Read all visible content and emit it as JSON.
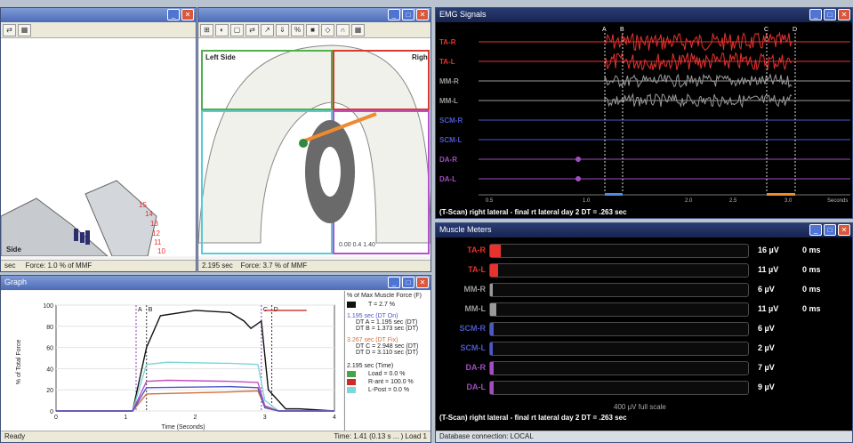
{
  "colors": {
    "red": "#e8322e",
    "gray": "#9a9a9a",
    "blue": "#4d57c8",
    "purple": "#a24ec2"
  },
  "force_window": {
    "status": "Force: 1.0 % of MMF",
    "left_status": "sec",
    "side_label": "Side",
    "numbers": [
      "15",
      "14",
      "13",
      "12",
      "11",
      "10"
    ]
  },
  "arch_window": {
    "title": "",
    "left_label": "Left Side",
    "right_label": "Righ",
    "time": "2.195 sec",
    "status": "Force: 3.7 % of MMF",
    "coords": "0.00 0.4 1.40"
  },
  "graph_window": {
    "title": "Graph",
    "y_label": "% of Total Force",
    "x_label": "Time (Seconds)",
    "status_left": "Ready",
    "status_right": "Time: 1.41 (0.13 s ... ) Load 1",
    "legend": {
      "header": "% of Max Muscle Force (F)",
      "total": "T = 2.7 %",
      "sel1": "1.195 sec (DT On)",
      "sel1_a": "DT A = 1.195 sec (DT)",
      "sel1_b": "DT B = 1.373 sec (DT)",
      "sel2": "3.267 sec (DT Fix)",
      "sel2_a": "DT C = 2.948 sec (DT)",
      "sel2_b": "DT D = 3.110 sec (DT)",
      "time_row": "2.195 sec (Time)",
      "l1": "Load = 0.0 %",
      "l2": "R-ant = 100.0 %",
      "l3": "L-Post = 0.0 %"
    }
  },
  "chart_data": {
    "type": "line",
    "xlim": [
      0,
      4
    ],
    "ylim": [
      0,
      100
    ],
    "x_ticks": [
      "0",
      "1",
      "2",
      "3",
      "4"
    ],
    "y_ticks": [
      "0",
      "20",
      "40",
      "60",
      "80",
      "100"
    ],
    "markers": [
      "A",
      "B",
      "C",
      "D"
    ],
    "series": [
      {
        "color": "#111111",
        "points": [
          [
            0,
            0
          ],
          [
            1.1,
            0
          ],
          [
            1.3,
            60
          ],
          [
            1.5,
            90
          ],
          [
            2.0,
            95
          ],
          [
            2.5,
            93
          ],
          [
            2.7,
            85
          ],
          [
            2.8,
            78
          ],
          [
            2.95,
            85
          ],
          [
            3.05,
            20
          ],
          [
            3.3,
            2
          ],
          [
            3.5,
            2
          ],
          [
            4,
            0
          ]
        ]
      },
      {
        "color": "#7ed7d7",
        "points": [
          [
            0,
            0
          ],
          [
            1.1,
            0
          ],
          [
            1.3,
            44
          ],
          [
            1.6,
            46
          ],
          [
            2.5,
            45
          ],
          [
            2.9,
            44
          ],
          [
            3.0,
            10
          ],
          [
            3.2,
            0
          ],
          [
            4,
            0
          ]
        ]
      },
      {
        "color": "#c050c0",
        "points": [
          [
            0,
            0
          ],
          [
            1.1,
            0
          ],
          [
            1.3,
            28
          ],
          [
            1.6,
            29
          ],
          [
            2.5,
            28
          ],
          [
            2.9,
            27
          ],
          [
            3.0,
            5
          ],
          [
            3.2,
            0
          ],
          [
            4,
            0
          ]
        ]
      },
      {
        "color": "#d46e3a",
        "points": [
          [
            0,
            0
          ],
          [
            1.1,
            0
          ],
          [
            1.3,
            16
          ],
          [
            2.5,
            18
          ],
          [
            2.9,
            19
          ],
          [
            3.0,
            4
          ],
          [
            3.2,
            0
          ],
          [
            4,
            0
          ]
        ]
      },
      {
        "color": "#4d57c8",
        "points": [
          [
            0,
            0
          ],
          [
            1.1,
            0
          ],
          [
            1.3,
            22
          ],
          [
            2.5,
            23
          ],
          [
            2.9,
            22
          ],
          [
            3.0,
            3
          ],
          [
            3.2,
            0
          ],
          [
            4,
            0
          ]
        ]
      },
      {
        "color": "#d12929",
        "points": [
          [
            3.0,
            95
          ],
          [
            3.6,
            95
          ]
        ]
      }
    ]
  },
  "emg_window": {
    "title": "EMG Signals",
    "channels": [
      "TA-R",
      "TA-L",
      "MM-R",
      "MM-L",
      "SCM-R",
      "SCM-L",
      "DA-R",
      "DA-L"
    ],
    "channel_colors": [
      "#e8322e",
      "#e8322e",
      "#9a9a9a",
      "#9a9a9a",
      "#4d57c8",
      "#4d57c8",
      "#a24ec2",
      "#a24ec2"
    ],
    "markers": [
      "A",
      "B",
      "C",
      "D"
    ],
    "ticks": [
      "0.5",
      "1.0",
      "2.0",
      "2.5",
      "3.0"
    ],
    "unit": "Seconds",
    "caption": "(T-Scan) right lateral - final rt lateral day 2 DT = .263 sec"
  },
  "meter_window": {
    "title": "Muscle Meters",
    "rows": [
      {
        "name": "TA-R",
        "value": "16 µV",
        "ms": "0 ms",
        "color": "#e8322e",
        "fill": 0.04
      },
      {
        "name": "TA-L",
        "value": "11 µV",
        "ms": "0 ms",
        "color": "#e8322e",
        "fill": 0.03
      },
      {
        "name": "MM-R",
        "value": "6 µV",
        "ms": "0 ms",
        "color": "#9a9a9a",
        "fill": 0.01
      },
      {
        "name": "MM-L",
        "value": "11 µV",
        "ms": "0 ms",
        "color": "#9a9a9a",
        "fill": 0.025
      },
      {
        "name": "SCM-R",
        "value": "6 µV",
        "ms": "",
        "color": "#4d57c8",
        "fill": 0.012
      },
      {
        "name": "SCM-L",
        "value": "2 µV",
        "ms": "",
        "color": "#4d57c8",
        "fill": 0.006
      },
      {
        "name": "DA-R",
        "value": "7 µV",
        "ms": "",
        "color": "#a24ec2",
        "fill": 0.012
      },
      {
        "name": "DA-L",
        "value": "9 µV",
        "ms": "",
        "color": "#a24ec2",
        "fill": 0.015
      }
    ],
    "scale": "400 µV full scale",
    "caption": "(T-Scan) right lateral - final rt lateral day 2 DT = .263 sec",
    "status": "Database connection: LOCAL"
  }
}
